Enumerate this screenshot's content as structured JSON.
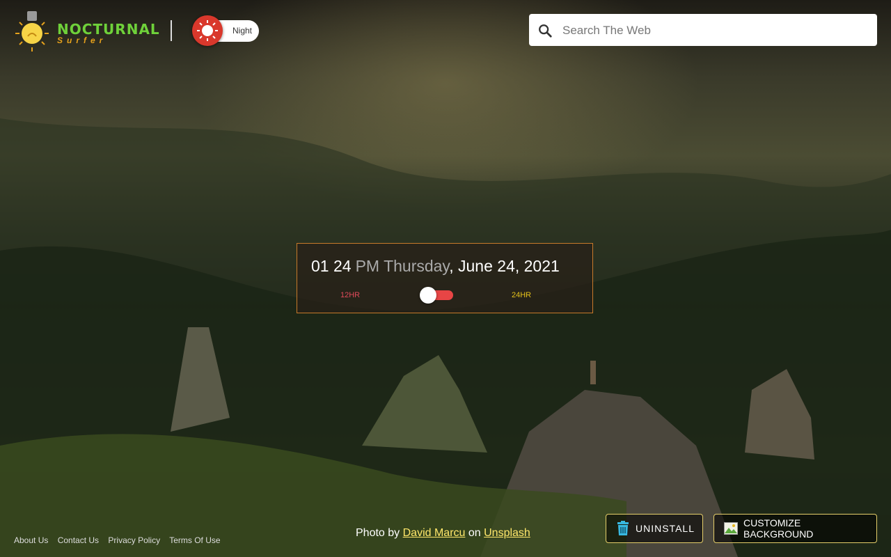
{
  "brand": {
    "title": "NOCTURNAL",
    "subtitle": "Surfer"
  },
  "theme_toggle": {
    "label": "Night",
    "accent": "#d9382c"
  },
  "search": {
    "placeholder": "Search The Web",
    "value": ""
  },
  "clock": {
    "time": "01 24",
    "ampm": "PM",
    "weekday": "Thursday",
    "date": ", June 24, 2021",
    "format_12_label": "12HR",
    "format_24_label": "24HR",
    "format_24_enabled": false
  },
  "credit": {
    "prefix": "Photo by",
    "author": "David Marcu",
    "middle": "on",
    "source": "Unsplash"
  },
  "footer_links": [
    "About Us",
    "Contact Us",
    "Privacy Policy",
    "Terms Of Use"
  ],
  "buttons": {
    "uninstall": "UNINSTALL",
    "customize": "CUSTOMIZE BACKGROUND"
  },
  "colors": {
    "accent_green": "#6fd13a",
    "accent_orange": "#e5a11c",
    "border_gold": "#e6cf6a"
  }
}
